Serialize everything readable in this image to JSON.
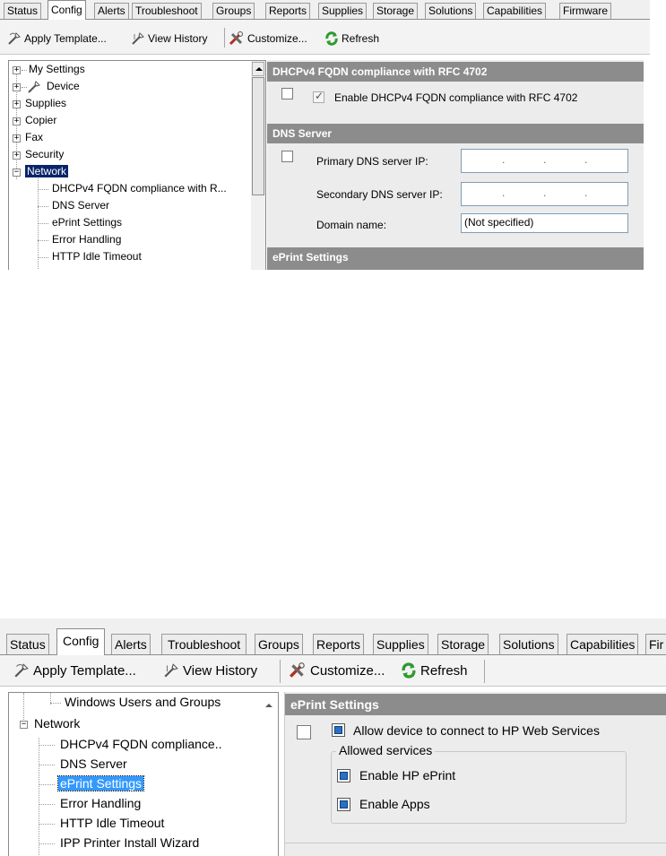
{
  "screenshot_top": {
    "tabs": [
      "Status",
      "Config",
      "Alerts",
      "Troubleshoot",
      "Groups",
      "Reports",
      "Supplies",
      "Storage",
      "Solutions",
      "Capabilities",
      "Firmware"
    ],
    "toolbar": {
      "apply_template": "Apply Template...",
      "view_history": "View History",
      "customize": "Customize...",
      "refresh": "Refresh"
    },
    "tree": [
      {
        "label": "My Settings",
        "expander": "+"
      },
      {
        "label": "Device",
        "expander": "+"
      },
      {
        "label": "Supplies",
        "expander": "+"
      },
      {
        "label": "Copier",
        "expander": "+"
      },
      {
        "label": "Fax",
        "expander": "+"
      },
      {
        "label": "Security",
        "expander": "+"
      },
      {
        "label": "Network",
        "expander": "−"
      },
      {
        "label": "DHCPv4 FQDN compliance with R..."
      },
      {
        "label": "DNS Server"
      },
      {
        "label": "ePrint Settings"
      },
      {
        "label": "Error Handling"
      },
      {
        "label": "HTTP Idle Timeout"
      }
    ],
    "sections": {
      "dhcp_header": "DHCPv4 FQDN compliance with RFC 4702",
      "dhcp_enable_label": "Enable DHCPv4 FQDN compliance with RFC 4702",
      "dns_header": "DNS Server",
      "primary_dns_label": "Primary DNS server IP:",
      "secondary_dns_label": "Secondary DNS server IP:",
      "domain_name_label": "Domain name:",
      "domain_name_value": "(Not specified)",
      "eprint_header": "ePrint Settings",
      "ip_dot": "."
    }
  },
  "screenshot_bottom": {
    "tabs": [
      "Status",
      "Config",
      "Alerts",
      "Troubleshoot",
      "Groups",
      "Reports",
      "Supplies",
      "Storage",
      "Solutions",
      "Capabilities",
      "Fir"
    ],
    "toolbar": {
      "apply_template": "Apply Template...",
      "view_history": "View History",
      "customize": "Customize...",
      "refresh": "Refresh"
    },
    "tree": [
      {
        "label": "Windows Users and Groups"
      },
      {
        "label": "Network",
        "expander": "−"
      },
      {
        "label": "DHCPv4 FQDN compliance.."
      },
      {
        "label": "DNS Server"
      },
      {
        "label": "ePrint Settings"
      },
      {
        "label": "Error Handling"
      },
      {
        "label": "HTTP Idle Timeout"
      },
      {
        "label": "IPP Printer Install Wizard"
      }
    ],
    "sections": {
      "eprint_header": "ePrint Settings",
      "allow_label": "Allow device to connect to HP Web Services",
      "allowed_services": "Allowed services",
      "enable_eprint": "Enable HP ePrint",
      "enable_apps": "Enable Apps"
    }
  },
  "colors": {
    "section_header_bg": "#8c8c8c",
    "selection_dark": "#0a246a",
    "selection_light": "#3399ff",
    "content_bg": "#ececec"
  }
}
